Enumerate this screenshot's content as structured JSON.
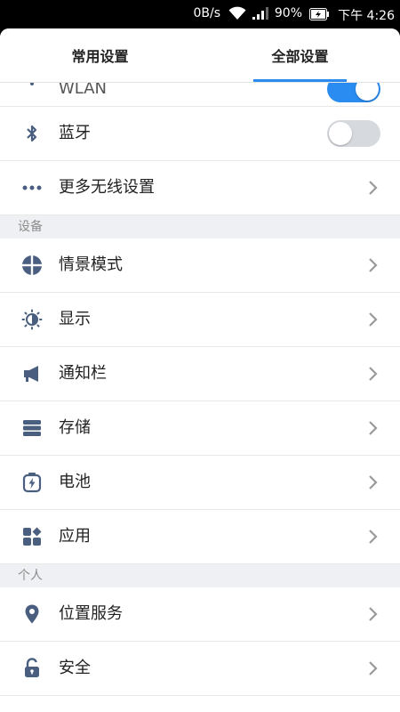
{
  "status_bar": {
    "net_speed": "0B/s",
    "battery": "90%",
    "time": "下午 4:26"
  },
  "tabs": [
    {
      "label": "常用设置",
      "active": false
    },
    {
      "label": "全部设置",
      "active": true
    }
  ],
  "accent_color": "#2a8cf0",
  "wireless": {
    "wlan": {
      "label": "WLAN",
      "icon": "wifi-icon",
      "on": true
    },
    "bluetooth": {
      "label": "蓝牙",
      "icon": "bluetooth-icon",
      "on": false
    },
    "more": {
      "label": "更多无线设置",
      "icon": "more-dots-icon"
    }
  },
  "sections": {
    "device": "设备",
    "personal": "个人"
  },
  "device_items": [
    {
      "label": "情景模式",
      "icon": "profile-mode-icon"
    },
    {
      "label": "显示",
      "icon": "brightness-icon"
    },
    {
      "label": "通知栏",
      "icon": "megaphone-icon"
    },
    {
      "label": "存储",
      "icon": "storage-icon"
    },
    {
      "label": "电池",
      "icon": "battery-icon"
    },
    {
      "label": "应用",
      "icon": "apps-icon"
    }
  ],
  "personal_items": [
    {
      "label": "位置服务",
      "icon": "location-pin-icon"
    },
    {
      "label": "安全",
      "icon": "lock-icon"
    }
  ]
}
